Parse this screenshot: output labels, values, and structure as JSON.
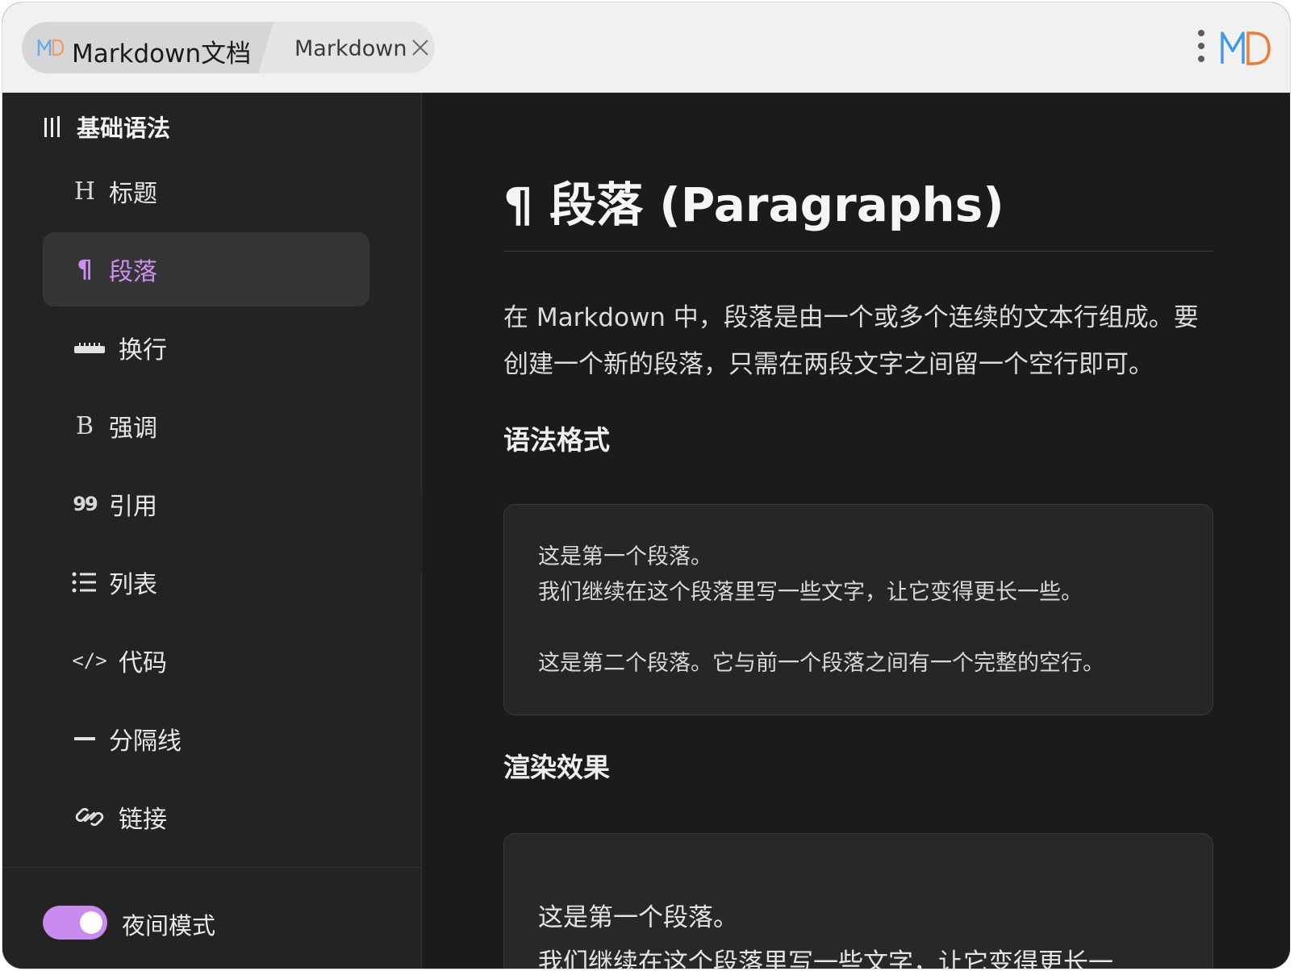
{
  "titlebar": {
    "tab_primary_title": "Markdown文档",
    "tab_secondary_title": "Markdown",
    "app_logo_text": "MD"
  },
  "sidebar": {
    "section_title": "基础语法",
    "items": [
      {
        "icon": "heading-icon",
        "glyph": "H",
        "label": "标题",
        "active": false
      },
      {
        "icon": "pilcrow-icon",
        "glyph": "¶",
        "label": "段落",
        "active": true
      },
      {
        "icon": "line-break-icon",
        "glyph": "",
        "label": "换行",
        "active": false
      },
      {
        "icon": "bold-icon",
        "glyph": "B",
        "label": "强调",
        "active": false
      },
      {
        "icon": "quote-icon",
        "glyph": "99",
        "label": "引用",
        "active": false
      },
      {
        "icon": "list-icon",
        "glyph": "",
        "label": "列表",
        "active": false
      },
      {
        "icon": "code-icon",
        "glyph": "</>",
        "label": "代码",
        "active": false
      },
      {
        "icon": "horizontal-rule-icon",
        "glyph": "—",
        "label": "分隔线",
        "active": false
      },
      {
        "icon": "link-icon",
        "glyph": "",
        "label": "链接",
        "active": false
      }
    ],
    "night_mode_label": "夜间模式",
    "night_mode_on": true
  },
  "main": {
    "title": "¶ 段落 (Paragraphs)",
    "intro_line1": "在 Markdown 中，段落是由一个或多个连续的文本行组成。要",
    "intro_line2": "创建一个新的段落，只需在两段文字之间留一个空行即可。",
    "syntax_heading": "语法格式",
    "code_lines": [
      "这是第一个段落。",
      "我们继续在这个段落里写一些文字，让它变得更长一些。",
      "",
      "这是第二个段落。它与前一个段落之间有一个完整的空行。"
    ],
    "render_heading": "渲染效果",
    "render_lines": [
      "这是第一个段落。",
      "我们继续在这个段落里写一些文字，让它变得更长一"
    ]
  },
  "colors": {
    "accent": "#c98af0",
    "sidebar_bg": "#232323",
    "main_bg": "#1b1b1b",
    "titlebar_bg": "#f1f1f1"
  }
}
